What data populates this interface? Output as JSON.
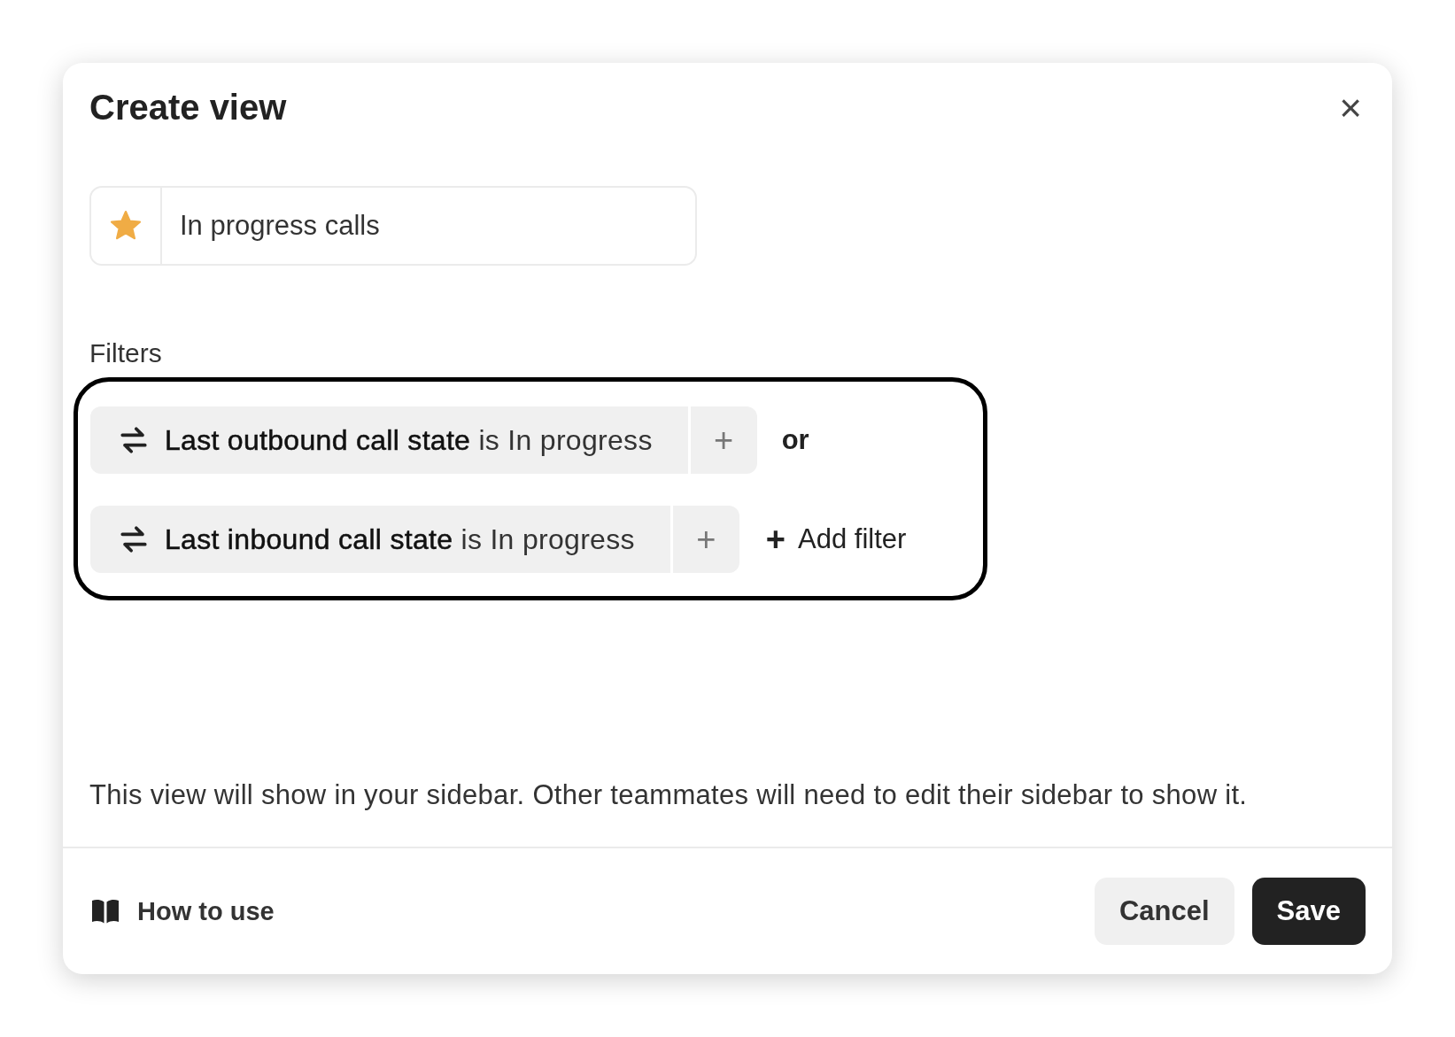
{
  "dialog": {
    "title": "Create view",
    "close": "×"
  },
  "name_field": {
    "starred": true,
    "value": "In progress calls"
  },
  "filters_label": "Filters",
  "filters": [
    {
      "text": "**Last outbound call state** is In progress"
    },
    {
      "text": "**Last inbound call state** is In progress"
    }
  ],
  "connector": "or",
  "add_filter": {
    "icon": "+",
    "label": "Add filter"
  },
  "add_condition": "+",
  "note": "This view will show in your sidebar. Other teammates will need to edit their sidebar to show it.",
  "footer": {
    "help_link": "How to use",
    "buttons": [
      {
        "label": "Cancel",
        "kind": "secondary"
      },
      {
        "label": "Save",
        "kind": "primary"
      }
    ]
  }
}
